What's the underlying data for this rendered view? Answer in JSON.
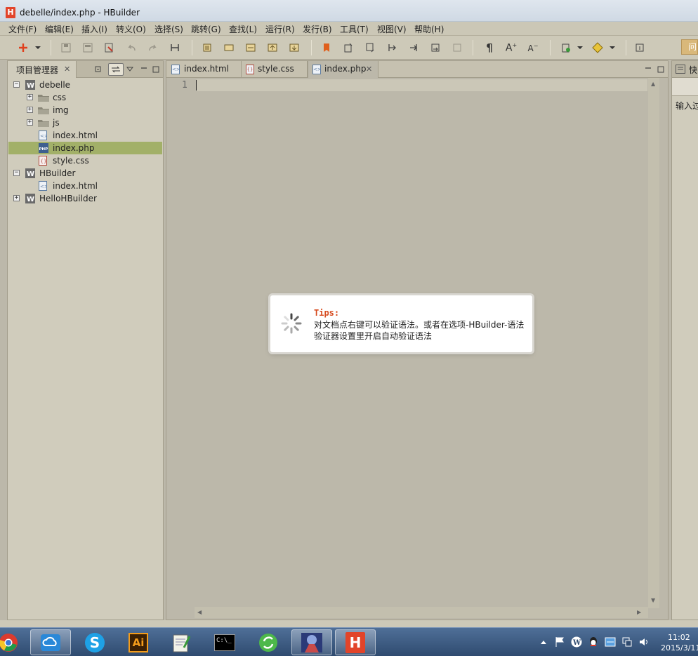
{
  "window": {
    "title": "debelle/index.php  -  HBuilder",
    "logo": "H"
  },
  "menu": [
    "文件(F)",
    "编辑(E)",
    "插入(I)",
    "转义(O)",
    "选择(S)",
    "跳转(G)",
    "查找(L)",
    "运行(R)",
    "发行(B)",
    "工具(T)",
    "视图(V)",
    "帮助(H)"
  ],
  "toolbar": {
    "help_tab": "问"
  },
  "project_panel": {
    "title": "项目管理器",
    "tree": [
      {
        "label": "debelle",
        "type": "project",
        "expander": "−"
      },
      {
        "label": "css",
        "type": "folder",
        "expander": "+"
      },
      {
        "label": "img",
        "type": "folder",
        "expander": "+"
      },
      {
        "label": "js",
        "type": "folder",
        "expander": "+"
      },
      {
        "label": "index.html",
        "type": "html"
      },
      {
        "label": "index.php",
        "type": "php",
        "selected": true
      },
      {
        "label": "style.css",
        "type": "css"
      },
      {
        "label": "HBuilder",
        "type": "project",
        "expander": "−"
      },
      {
        "label": "index.html",
        "type": "html"
      },
      {
        "label": "HelloHBuilder",
        "type": "project",
        "expander": "+"
      }
    ]
  },
  "editor": {
    "tabs": [
      {
        "label": "index.html",
        "icon": "html"
      },
      {
        "label": "style.css",
        "icon": "css"
      },
      {
        "label": "index.php",
        "icon": "php",
        "active": true
      }
    ],
    "line_number": "1"
  },
  "right_panel": {
    "tab_label": "快",
    "input_label": "输入过"
  },
  "tips": {
    "title": "Tips:",
    "body": "对文档点右键可以验证语法。或者在选项-HBuilder-语法验证器设置里开启自动验证语法"
  },
  "taskbar": {
    "apps": [
      "chrome",
      "cloud",
      "skype",
      "illustrator",
      "notepad",
      "cmd",
      "refresh",
      "game",
      "hbuilder"
    ],
    "illustrator_label": "Ai",
    "cmd_label": "C:\\_",
    "skype_label": "S",
    "hbuilder_label": "H",
    "clock_time": "11:02",
    "clock_date": "2015/3/11"
  }
}
